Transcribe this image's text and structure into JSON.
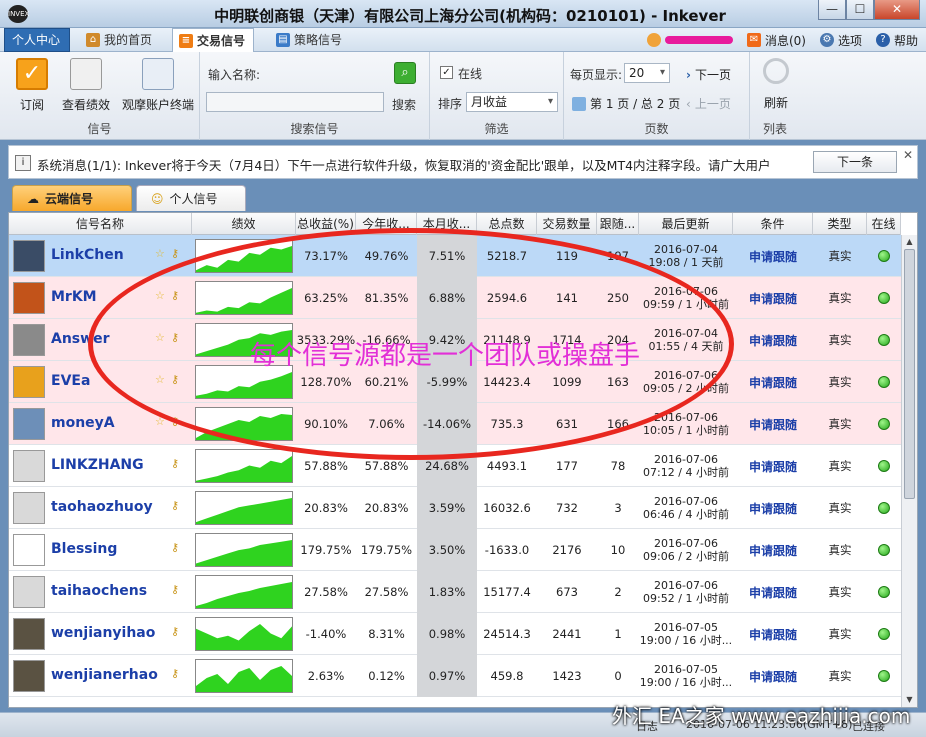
{
  "window": {
    "title": "中明联创商银（天津）有限公司上海分公司(机构码：0210101) - Inkever",
    "logo_text": "INVEX",
    "min_glyph": "—",
    "max_glyph": "☐",
    "close_glyph": "✕"
  },
  "nav": {
    "user_center": "个人中心",
    "home": "我的首页",
    "signals": "交易信号",
    "strategy": "策略信号",
    "messages": "消息(0)",
    "options": "选项",
    "help": "帮助"
  },
  "ribbon": {
    "subscribe": "订阅",
    "view_perf": "查看绩效",
    "watch_terminal": "观摩账户终端",
    "group_signal": "信号",
    "name_label": "输入名称:",
    "name_value": "",
    "search_btn": "搜索",
    "group_search": "搜索信号",
    "online_label": "在线",
    "online_checked": "✓",
    "sort_label": "排序",
    "sort_value": "月收益",
    "group_filter": "筛选",
    "per_page_label": "每页显示:",
    "per_page_value": "20",
    "next_page": "下一页",
    "page_info": "第 1 页 / 总 2 页",
    "prev_page": "上一页",
    "group_pages": "页数",
    "refresh": "刷新",
    "group_list": "列表"
  },
  "system_message": {
    "text": "系统消息(1/1):  Inkever将于今天（7月4日）下午一点进行软件升级，恢复取消的'资金配比'跟单，以及MT4内注释字段。请广大用户",
    "next_btn": "下一条",
    "close": "✕"
  },
  "tabs": {
    "cloud": "云端信号",
    "personal": "个人信号"
  },
  "table": {
    "headers": [
      "信号名称",
      "绩效",
      "总收益(%)",
      "今年收...",
      "本月收...",
      "总点数",
      "交易数量",
      "跟随...",
      "最后更新",
      "条件",
      "类型",
      "在线"
    ],
    "rows": [
      {
        "name": "LinkChen",
        "total": "73.17%",
        "ytd": "49.76%",
        "month": "7.51%",
        "points": "5218.7",
        "trades": "119",
        "followers": "197",
        "date": "2016-07-04",
        "ago": "19:08 / 1 天前",
        "cond": "申请跟随",
        "type": "真实",
        "star": true,
        "row_style": "selected",
        "avatar": "#3a4c66",
        "spark": [
          2,
          8,
          5,
          14,
          12,
          22,
          20,
          28,
          26,
          30
        ]
      },
      {
        "name": "MrKM",
        "total": "63.25%",
        "ytd": "81.35%",
        "month": "6.88%",
        "points": "2594.6",
        "trades": "141",
        "followers": "250",
        "date": "2016-07-06",
        "ago": "09:59 / 1 小时前",
        "cond": "申请跟随",
        "type": "真实",
        "star": true,
        "row_style": "pink",
        "avatar": "#c2531a",
        "spark": [
          1,
          3,
          2,
          6,
          5,
          10,
          9,
          14,
          18,
          22
        ]
      },
      {
        "name": "Answer",
        "total": "3533.29%",
        "ytd": "-16.66%",
        "month": "9.42%",
        "points": "21148.9",
        "trades": "1714",
        "followers": "204",
        "date": "2016-07-04",
        "ago": "01:55 / 4 天前",
        "cond": "申请跟随",
        "type": "真实",
        "star": true,
        "row_style": "pink",
        "avatar": "#8a8a8a",
        "spark": [
          2,
          6,
          10,
          14,
          20,
          22,
          28,
          26,
          30,
          32
        ]
      },
      {
        "name": "EVEa",
        "total": "128.70%",
        "ytd": "60.21%",
        "month": "-5.99%",
        "points": "14423.4",
        "trades": "1099",
        "followers": "163",
        "date": "2016-07-06",
        "ago": "09:05 / 2 小时前",
        "cond": "申请跟随",
        "type": "真实",
        "star": true,
        "row_style": "pink",
        "avatar": "#e8a11c",
        "spark": [
          2,
          4,
          7,
          6,
          11,
          10,
          15,
          17,
          20,
          24
        ]
      },
      {
        "name": "moneyA",
        "total": "90.10%",
        "ytd": "7.06%",
        "month": "-14.06%",
        "points": "735.3",
        "trades": "631",
        "followers": "166",
        "date": "2016-07-06",
        "ago": "10:05 / 1 小时前",
        "cond": "申请跟随",
        "type": "真实",
        "star": true,
        "row_style": "pink",
        "avatar": "#6d8fb8",
        "spark": [
          2,
          8,
          12,
          16,
          20,
          18,
          24,
          22,
          26,
          25
        ]
      },
      {
        "name": "LINKZHANG",
        "total": "57.88%",
        "ytd": "57.88%",
        "month": "24.68%",
        "points": "4493.1",
        "trades": "177",
        "followers": "78",
        "date": "2016-07-06",
        "ago": "07:12 / 4 小时前",
        "cond": "申请跟随",
        "type": "真实",
        "star": false,
        "row_style": "plain",
        "avatar": "#d9d9d9",
        "spark": [
          1,
          3,
          5,
          8,
          10,
          14,
          12,
          18,
          16,
          22
        ]
      },
      {
        "name": "taohaozhuoy",
        "total": "20.83%",
        "ytd": "20.83%",
        "month": "3.59%",
        "points": "16032.6",
        "trades": "732",
        "followers": "3",
        "date": "2016-07-06",
        "ago": "06:46 / 4 小时前",
        "cond": "申请跟随",
        "type": "真实",
        "star": false,
        "row_style": "plain",
        "avatar": "#d9d9d9",
        "spark": [
          2,
          6,
          10,
          14,
          18,
          20,
          22,
          24,
          26,
          28
        ]
      },
      {
        "name": "Blessing",
        "total": "179.75%",
        "ytd": "179.75%",
        "month": "3.50%",
        "points": "-1633.0",
        "trades": "2176",
        "followers": "10",
        "date": "2016-07-06",
        "ago": "09:06 / 2 小时前",
        "cond": "申请跟随",
        "type": "真实",
        "star": false,
        "row_style": "plain",
        "avatar": "#ffffff",
        "spark": [
          3,
          7,
          11,
          15,
          19,
          21,
          25,
          27,
          29,
          31
        ]
      },
      {
        "name": "taihaochens",
        "total": "27.58%",
        "ytd": "27.58%",
        "month": "1.83%",
        "points": "15177.4",
        "trades": "673",
        "followers": "2",
        "date": "2016-07-06",
        "ago": "09:52 / 1 小时前",
        "cond": "申请跟随",
        "type": "真实",
        "star": false,
        "row_style": "plain",
        "avatar": "#d9d9d9",
        "spark": [
          2,
          5,
          9,
          12,
          15,
          17,
          20,
          22,
          24,
          26
        ]
      },
      {
        "name": "wenjianyihao",
        "total": "-1.40%",
        "ytd": "8.31%",
        "month": "0.98%",
        "points": "24514.3",
        "trades": "2441",
        "followers": "1",
        "date": "2016-07-05",
        "ago": "19:00 / 16 小时...",
        "cond": "申请跟随",
        "type": "真实",
        "star": false,
        "row_style": "plain",
        "avatar": "#5a5242",
        "spark": [
          18,
          14,
          10,
          12,
          8,
          16,
          22,
          14,
          10,
          20
        ]
      },
      {
        "name": "wenjianerhao",
        "total": "2.63%",
        "ytd": "0.12%",
        "month": "0.97%",
        "points": "459.8",
        "trades": "1423",
        "followers": "0",
        "date": "2016-07-05",
        "ago": "19:00 / 16 小时...",
        "cond": "申请跟随",
        "type": "真实",
        "star": false,
        "row_style": "plain",
        "avatar": "#5a5242",
        "spark": [
          6,
          14,
          18,
          8,
          20,
          24,
          12,
          22,
          26,
          16
        ]
      }
    ]
  },
  "annotation": {
    "text": "每个信号源都是一个团队或操盘手"
  },
  "status": {
    "prefix": "日志",
    "time": "2016-07-06 11:23:06(GMT+8)",
    "connection": "已连接",
    "watermark": "外汇 EA之家 www.eazhijia.com"
  },
  "colors": {
    "spark_fill": "#2fd31f",
    "online_dot": "#26a81c",
    "link_blue": "#1c3fa8"
  }
}
